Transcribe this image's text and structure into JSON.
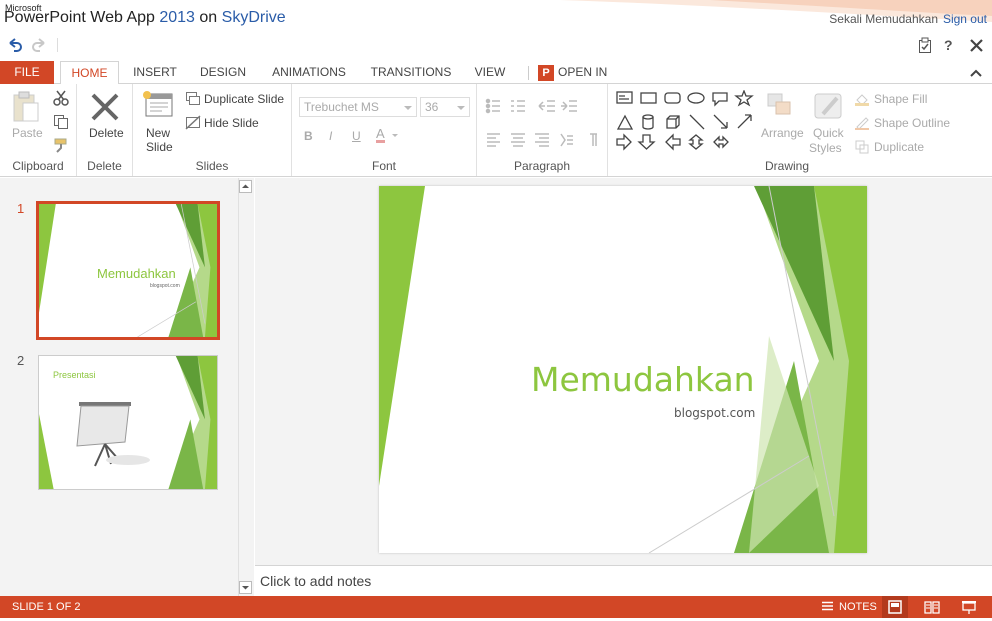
{
  "header": {
    "brand_small": "Microsoft",
    "app_name": "PowerPoint Web App",
    "app_year": "2013",
    "on_word": "on",
    "service": "SkyDrive",
    "user_name": "Sekali Memudahkan",
    "sign_out": "Sign out"
  },
  "tabs": [
    "FILE",
    "HOME",
    "INSERT",
    "DESIGN",
    "ANIMATIONS",
    "TRANSITIONS",
    "VIEW",
    "OPEN IN POWERPOINT"
  ],
  "ribbon": {
    "clipboard": {
      "paste": "Paste",
      "label": "Clipboard"
    },
    "delete": {
      "button": "Delete",
      "label": "Delete"
    },
    "slides": {
      "new_line1": "New",
      "new_line2": "Slide",
      "duplicate": "Duplicate Slide",
      "hide": "Hide Slide",
      "label": "Slides"
    },
    "font": {
      "family": "Trebuchet MS",
      "size": "36",
      "bold": "B",
      "italic": "I",
      "underline": "U",
      "color": "A",
      "label": "Font"
    },
    "paragraph": {
      "label": "Paragraph"
    },
    "drawing": {
      "arrange": "Arrange",
      "quick_line1": "Quick",
      "quick_line2": "Styles",
      "shape_fill": "Shape Fill",
      "shape_outline": "Shape Outline",
      "duplicate": "Duplicate",
      "label": "Drawing"
    }
  },
  "slides": [
    {
      "number": "1",
      "title": "Memudahkan",
      "subtitle": "blogspot.com"
    },
    {
      "number": "2",
      "title": "Presentasi"
    }
  ],
  "current_slide": {
    "title": "Memudahkan",
    "subtitle": "blogspot.com"
  },
  "notes_placeholder": "Click to add notes",
  "status": {
    "slide_info": "SLIDE 1 OF 2",
    "notes_label": "NOTES"
  },
  "colors": {
    "accent": "#d24726",
    "green_light": "#8dc63f",
    "green_dark": "#5a9a30",
    "link": "#2a5ca8"
  }
}
